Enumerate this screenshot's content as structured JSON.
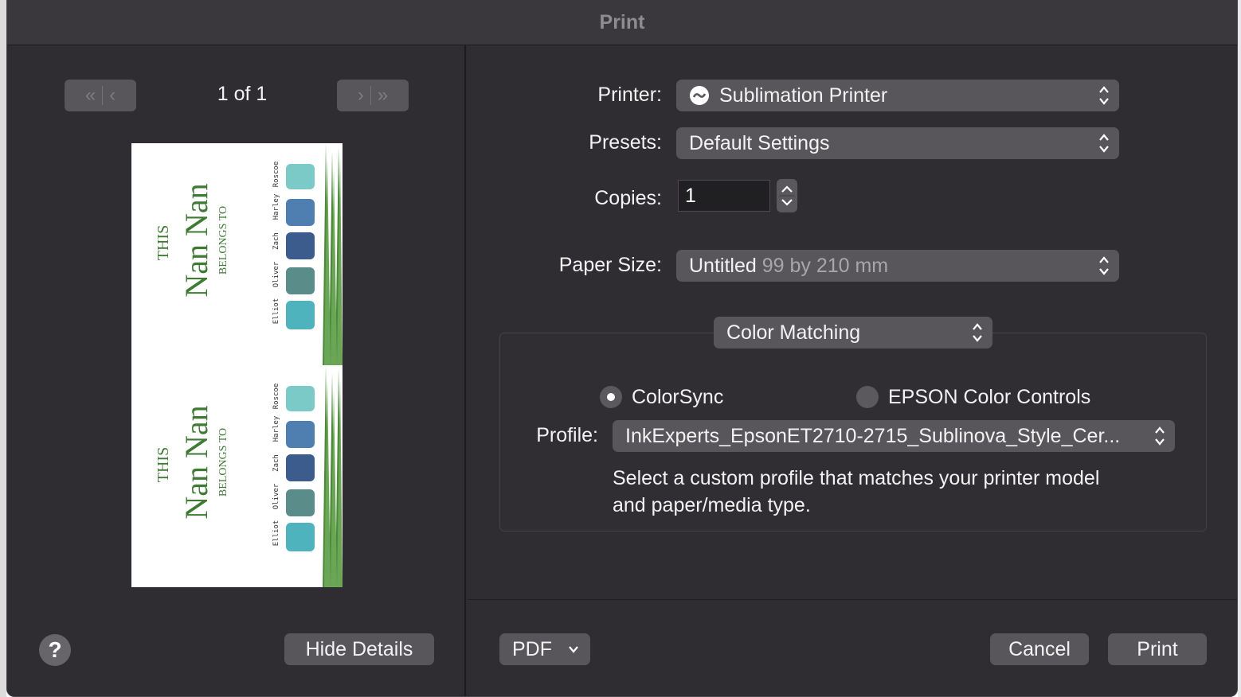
{
  "window": {
    "title": "Print"
  },
  "preview": {
    "page_indicator": "1 of 1",
    "sticker": {
      "line1": "THIS",
      "line2": "Nan Nan",
      "line3": "BELONGS TO",
      "names": [
        "Elliot",
        "Oliver",
        "Zach",
        "Harley",
        "Roscoe"
      ]
    }
  },
  "left_footer": {
    "help": "?",
    "hide_details": "Hide Details"
  },
  "printer": {
    "label": "Printer:",
    "value": "Sublimation Printer"
  },
  "presets": {
    "label": "Presets:",
    "value": "Default Settings"
  },
  "copies": {
    "label": "Copies:",
    "value": "1"
  },
  "paper_size": {
    "label": "Paper Size:",
    "value_name": "Untitled",
    "value_dims": "99 by 210 mm"
  },
  "panel": {
    "value": "Color Matching",
    "option_colorsync": "ColorSync",
    "option_epson": "EPSON Color Controls",
    "selected": "ColorSync",
    "profile_label": "Profile:",
    "profile_value": "InkExperts_EpsonET2710-2715_Sublinova_Style_Cer...",
    "help_line1": "Select a custom profile that matches your printer model",
    "help_line2": "and paper/media type."
  },
  "footer": {
    "pdf": "PDF",
    "cancel": "Cancel",
    "print": "Print"
  }
}
